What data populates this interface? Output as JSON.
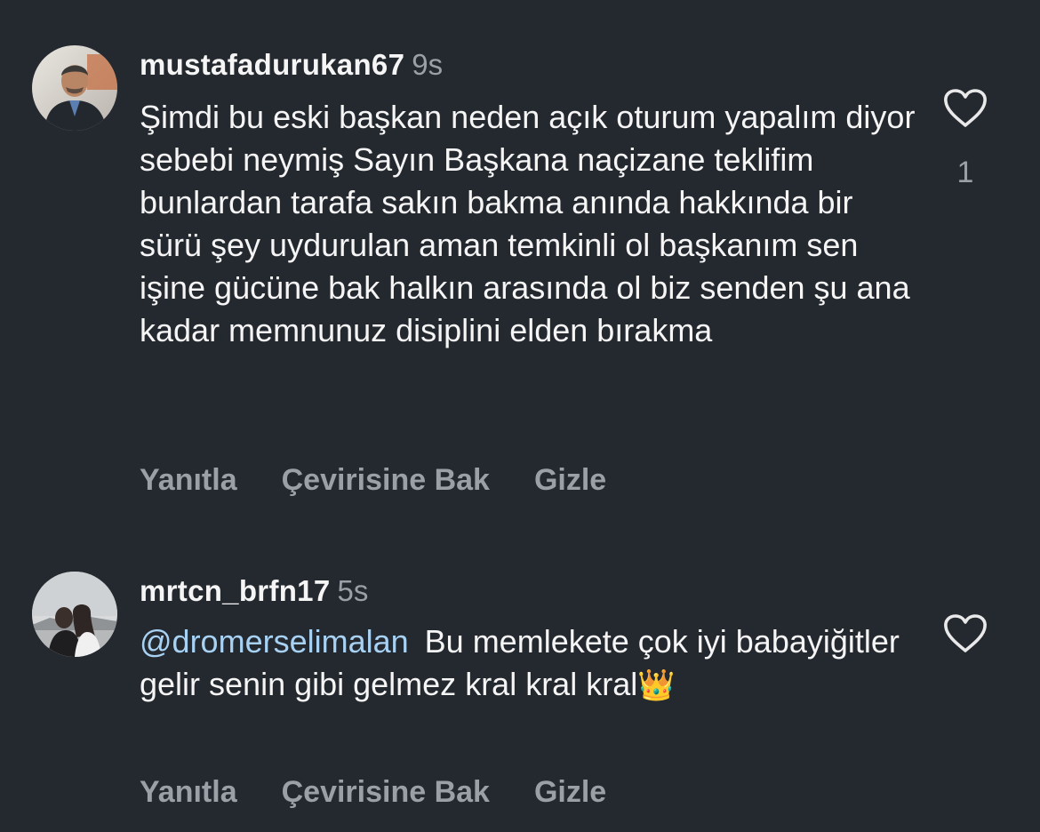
{
  "comments": [
    {
      "username": "mustafadurukan67",
      "time": "9s",
      "mention": "",
      "text": "Şimdi bu eski başkan neden açık oturum yapalım diyor sebebi neymiş Sayın Başkana naçizane teklifim bunlardan tarafa sakın bakma anında hakkında bir sürü şey uydurulan aman temkinli ol başkanım sen işine gücüne bak halkın arasında ol biz senden şu ana kadar memnunuz disiplini elden bırakma",
      "emoji": "",
      "like_count": "1",
      "actions": {
        "reply": "Yanıtla",
        "translate": "Çevirisine Bak",
        "hide": "Gizle"
      },
      "icons": {
        "avatar": "user-avatar",
        "like": "heart-outline-icon"
      }
    },
    {
      "username": "mrtcn_brfn17",
      "time": "5s",
      "mention": "@dromerselimalan",
      "text": "Bu memlekete çok iyi babayiğitler gelir senin gibi gelmez kral kral kral",
      "emoji": "👑",
      "like_count": "",
      "actions": {
        "reply": "Yanıtla",
        "translate": "Çevirisine Bak",
        "hide": "Gizle"
      },
      "icons": {
        "avatar": "user-avatar",
        "like": "heart-outline-icon"
      }
    }
  ],
  "colors": {
    "background": "#24282f",
    "text": "#f5f5f5",
    "muted": "#9b9fa6",
    "mention": "#a8d2f4"
  }
}
